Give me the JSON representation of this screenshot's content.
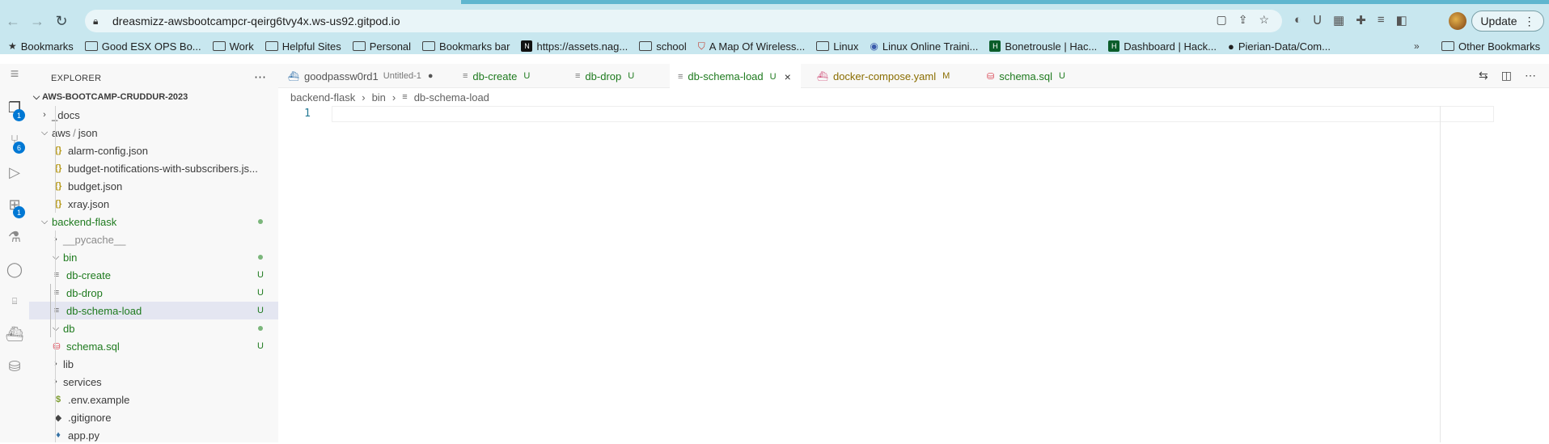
{
  "browser": {
    "url": "dreasmizz-awsbootcampcr-qeirg6tvy4x.ws-us92.gitpod.io",
    "update_label": "Update"
  },
  "bookmarks": [
    {
      "label": "Bookmarks",
      "icon": "star-icon"
    },
    {
      "label": "Good ESX OPS Bo...",
      "icon": "folder-icon"
    },
    {
      "label": "Work",
      "icon": "folder-icon"
    },
    {
      "label": "Helpful Sites",
      "icon": "folder-icon"
    },
    {
      "label": "Personal",
      "icon": "folder-icon"
    },
    {
      "label": "Bookmarks bar",
      "icon": "folder-icon"
    },
    {
      "label": "https://assets.nag...",
      "icon": "n-site-icon"
    },
    {
      "label": "school",
      "icon": "folder-icon"
    },
    {
      "label": "A Map Of Wireless...",
      "icon": "shield-site-icon"
    },
    {
      "label": "Linux",
      "icon": "folder-icon"
    },
    {
      "label": "Linux Online Traini...",
      "icon": "globe-site-icon"
    },
    {
      "label": "Bonetrousle | Hac...",
      "icon": "hackerrank-icon"
    },
    {
      "label": "Dashboard | Hack...",
      "icon": "hackerrank-icon"
    },
    {
      "label": "Pierian-Data/Com...",
      "icon": "github-icon"
    }
  ],
  "other_bookmarks": "Other Bookmarks",
  "activity_bar": {
    "explorer_badge": "1",
    "scm_badge": "6",
    "extensions_badge": "1"
  },
  "explorer": {
    "title": "EXPLORER",
    "root": "AWS-BOOTCAMP-CRUDDUR-2023",
    "items": {
      "docs": "_docs",
      "aws_json": "aws",
      "aws_json_sep": "/",
      "aws_json_child": "json",
      "alarm": "alarm-config.json",
      "budget_notif": "budget-notifications-with-subscribers.js...",
      "budget": "budget.json",
      "xray": "xray.json",
      "backend": "backend-flask",
      "pycache": "__pycache__",
      "bin": "bin",
      "db_create": "db-create",
      "db_drop": "db-drop",
      "db_schema_load": "db-schema-load",
      "db": "db",
      "schema": "schema.sql",
      "lib": "lib",
      "services": "services",
      "env": ".env.example",
      "gitignore": ".gitignore",
      "app": "app.py"
    },
    "status_u": "U"
  },
  "tabs": [
    {
      "label": "goodpassw0rd1",
      "desc": "Untitled-1",
      "mark": "●"
    },
    {
      "label": "db-create",
      "mark": "U"
    },
    {
      "label": "db-drop",
      "mark": "U"
    },
    {
      "label": "db-schema-load",
      "mark": "U"
    },
    {
      "label": "docker-compose.yaml",
      "mark": "M"
    },
    {
      "label": "schema.sql",
      "mark": "U"
    }
  ],
  "breadcrumbs": [
    "backend-flask",
    "bin",
    "db-schema-load"
  ],
  "editor": {
    "line_number": "1"
  }
}
